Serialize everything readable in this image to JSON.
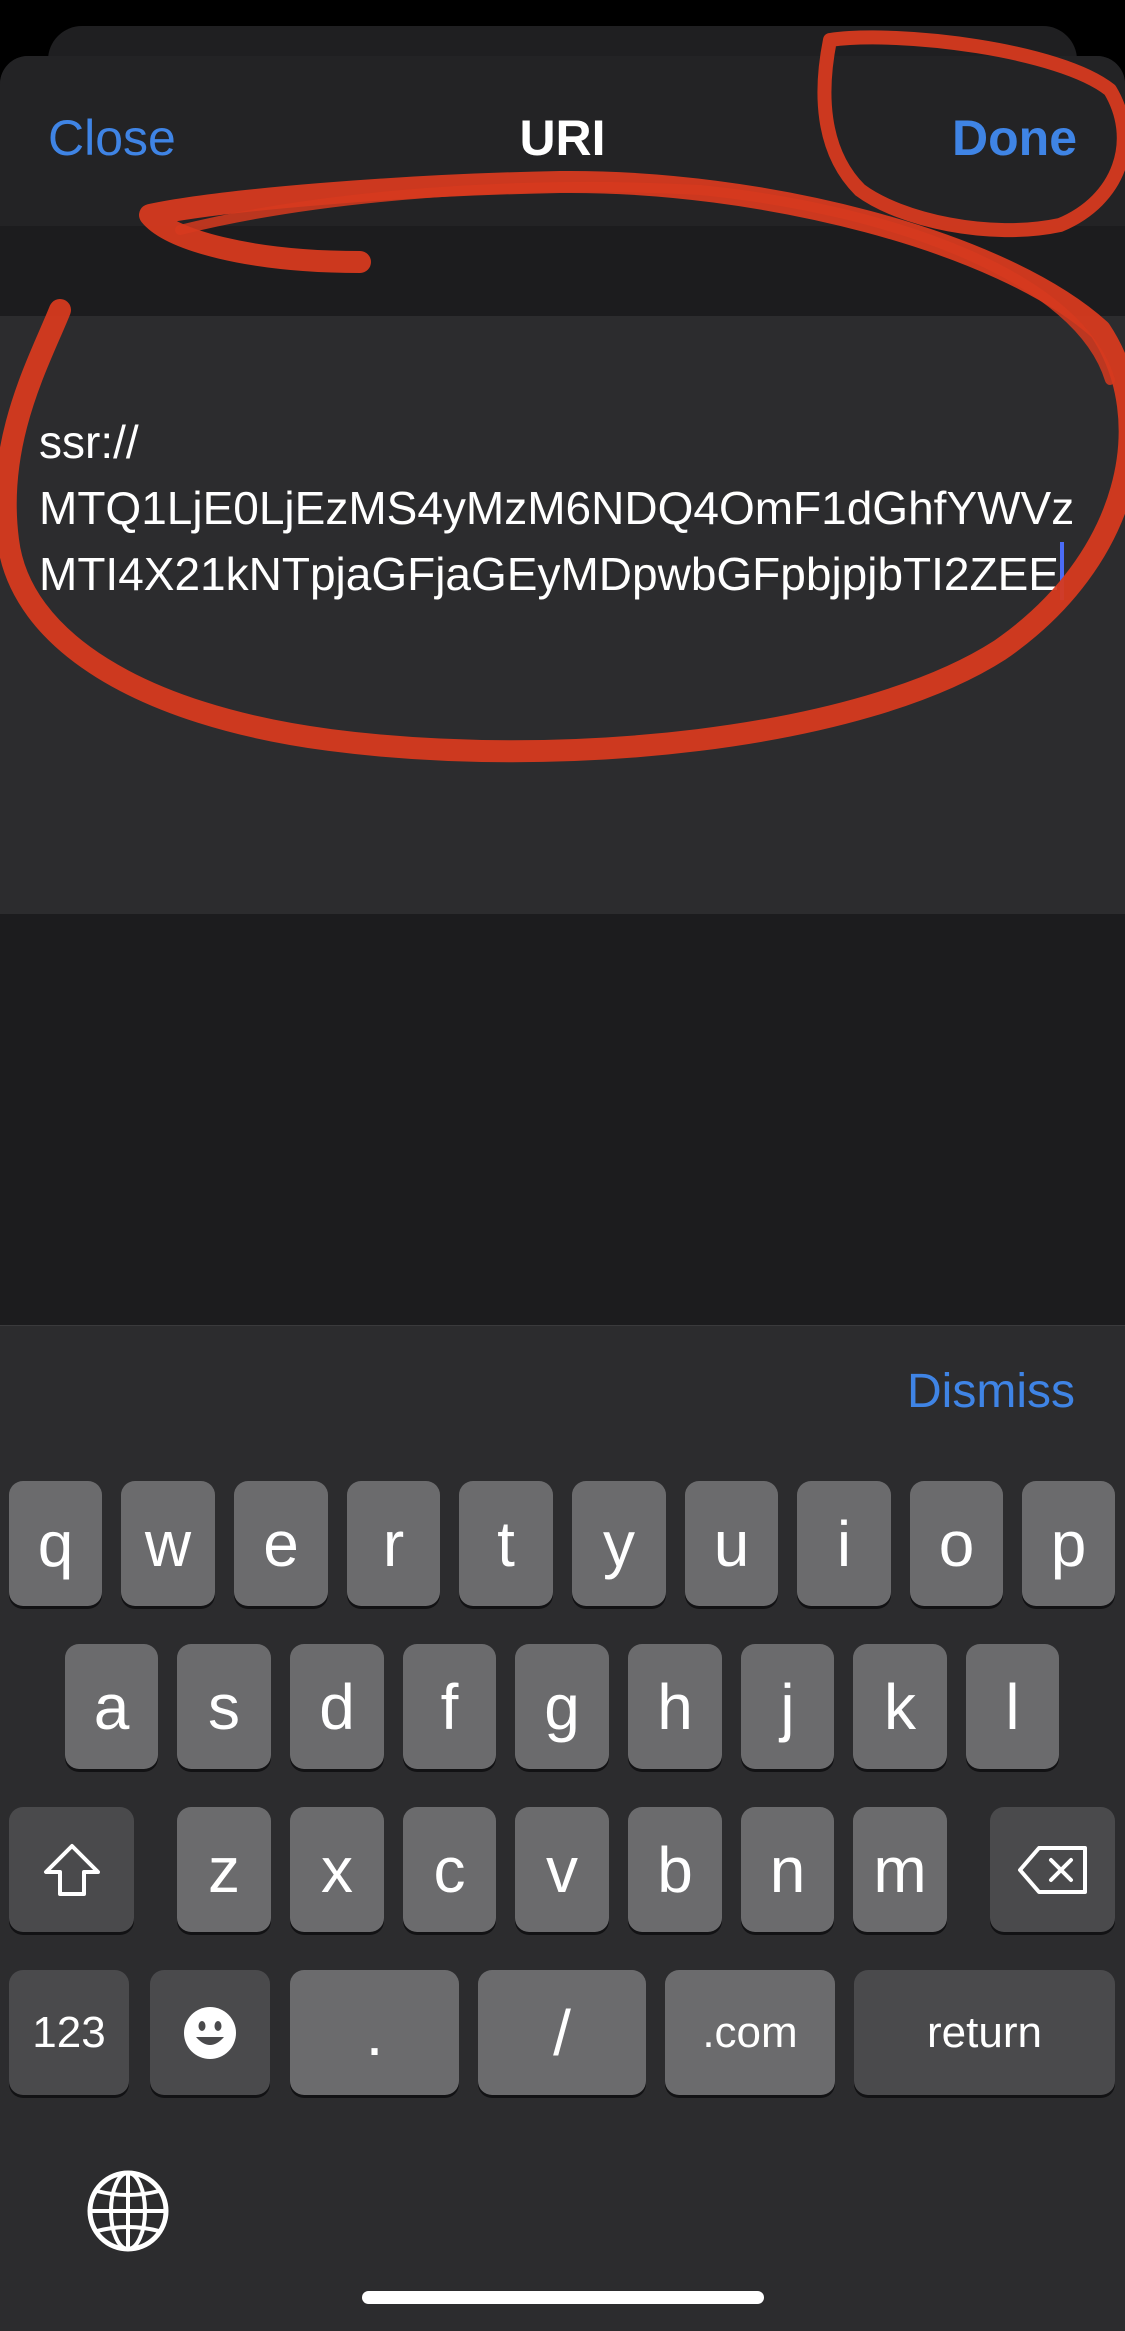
{
  "nav": {
    "close_label": "Close",
    "title": "URI",
    "done_label": "Done"
  },
  "uri_field": {
    "value": "ssr://\nMTQ1LjE0LjEzMS4yMzM6NDQ4OmF1dGhfYWVzMTI4X21kNTpjaGFjaGEyMDpwbGFpbjpjbTI2ZEE"
  },
  "keyboard_toolbar": {
    "dismiss_label": "Dismiss"
  },
  "keyboard": {
    "row1": [
      "q",
      "w",
      "e",
      "r",
      "t",
      "y",
      "u",
      "i",
      "o",
      "p"
    ],
    "row2": [
      "a",
      "s",
      "d",
      "f",
      "g",
      "h",
      "j",
      "k",
      "l"
    ],
    "row3": [
      "z",
      "x",
      "c",
      "v",
      "b",
      "n",
      "m"
    ],
    "numbers_label": "123",
    "period_label": ".",
    "slash_label": "/",
    "dotcom_label": ".com",
    "return_label": "return"
  },
  "icons": {
    "shift": "shift-arrow-icon",
    "delete": "backspace-icon",
    "emoji": "smiley-face-icon",
    "globe": "globe-icon"
  },
  "colors": {
    "accent": "#3f84e5",
    "annotation_red": "#d63a1f",
    "caret": "#4b6cf7",
    "key": "#6b6b6d",
    "key_dark": "#4a4a4c"
  }
}
